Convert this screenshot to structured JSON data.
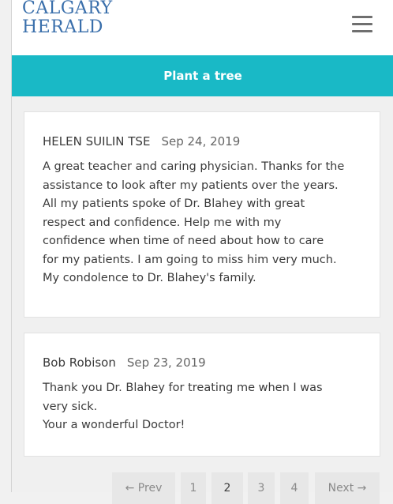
{
  "header": {
    "logo_line1": "CALGARY",
    "logo_line2": "HERALD",
    "menu_icon": "hamburger-menu-icon"
  },
  "banner": {
    "label": "Plant a tree"
  },
  "comments": [
    {
      "author": "HELEN SUILIN TSE",
      "date": "Sep 24, 2019",
      "lines": [
        "A great teacher and caring physician. Thanks for the",
        "assistance to look after my patients over the years.",
        "All my patients spoke of Dr. Blahey with great",
        "respect and confidence. Help me with my",
        "confidence when time of need about how to care",
        "for my patients. I am going to miss him very much.",
        "My condolence to Dr. Blahey's family."
      ]
    },
    {
      "author": "Bob Robison",
      "date": "Sep 23, 2019",
      "lines": [
        "Thank you Dr. Blahey for treating me when I was",
        "very sick.",
        "Your a wonderful Doctor!"
      ]
    }
  ],
  "pagination": {
    "prev": "← Prev",
    "pages": [
      "1",
      "2",
      "3",
      "4"
    ],
    "current_page": "2",
    "next": "Next →"
  },
  "colors": {
    "banner": "#19b9c6",
    "logo": "#3a6fab",
    "page_background": "#f0f0f0"
  }
}
